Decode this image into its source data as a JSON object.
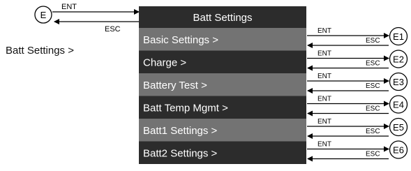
{
  "entry": {
    "node_label": "E",
    "enter_label": "ENT",
    "escape_label": "ESC",
    "side_label": "Batt Settings >"
  },
  "menu": {
    "title": "Batt Settings",
    "items": [
      {
        "label": "Basic Settings >",
        "target": "E1",
        "highlighted": true
      },
      {
        "label": "Charge >",
        "target": "E2",
        "highlighted": false
      },
      {
        "label": "Battery Test >",
        "target": "E3",
        "highlighted": true
      },
      {
        "label": "Batt Temp Mgmt >",
        "target": "E4",
        "highlighted": false
      },
      {
        "label": "Batt1 Settings >",
        "target": "E5",
        "highlighted": true
      },
      {
        "label": "Batt2 Settings >",
        "target": "E6",
        "highlighted": false
      }
    ]
  },
  "transitions": {
    "enter_label": "ENT",
    "escape_label": "ESC"
  },
  "colors": {
    "menu_dark": "#2c2c2c",
    "menu_highlight": "#737373",
    "menu_text": "#ffffff",
    "line": "#000000"
  }
}
